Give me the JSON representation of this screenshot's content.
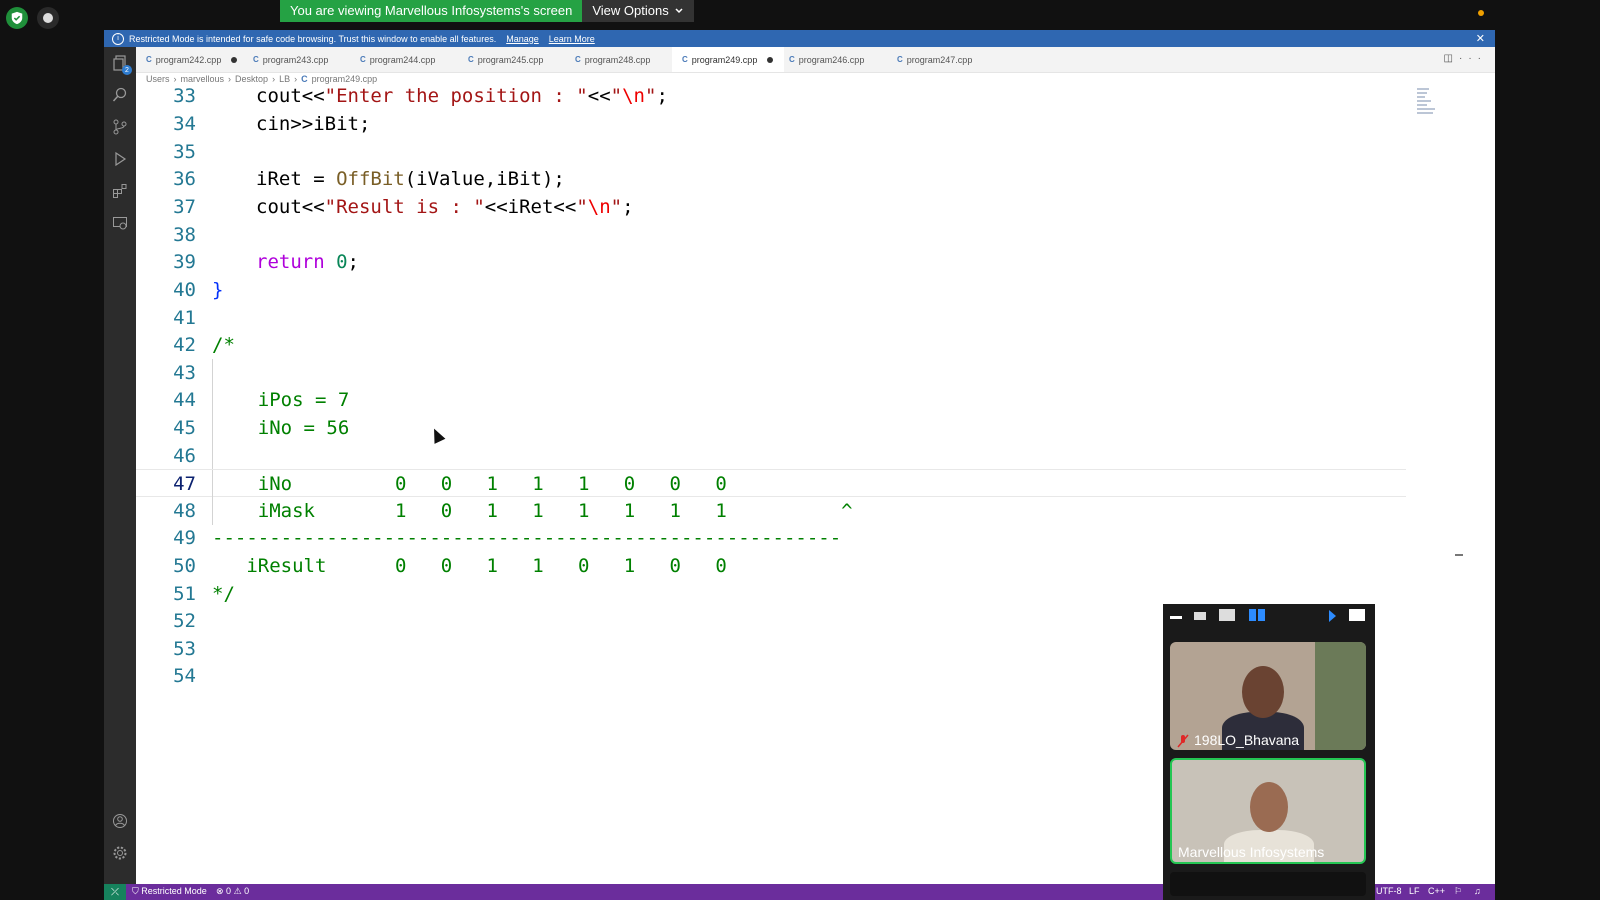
{
  "zoom": {
    "share_banner": "You are viewing Marvellous Infosystems's screen",
    "view_options": "View Options",
    "participants": [
      {
        "name": "198LO_Bhavana",
        "muted": true
      },
      {
        "name": "Marvellous Infosystems",
        "active_speaker": true
      }
    ]
  },
  "restricted_bar": {
    "message": "Restricted Mode is intended for safe code browsing. Trust this window to enable all features.",
    "manage": "Manage",
    "learn_more": "Learn More"
  },
  "tabs": [
    {
      "label": "program242.cpp",
      "modified": true
    },
    {
      "label": "program243.cpp",
      "modified": false
    },
    {
      "label": "program244.cpp",
      "modified": false
    },
    {
      "label": "program245.cpp",
      "modified": false
    },
    {
      "label": "program248.cpp",
      "modified": false
    },
    {
      "label": "program249.cpp",
      "modified": true,
      "active": true
    },
    {
      "label": "program246.cpp",
      "modified": false
    },
    {
      "label": "program247.cpp",
      "modified": false
    }
  ],
  "breadcrumb": [
    "Users",
    "marvellous",
    "Desktop",
    "LB",
    "program249.cpp"
  ],
  "editor": {
    "line_numbers": [
      "33",
      "34",
      "35",
      "36",
      "37",
      "38",
      "39",
      "40",
      "41",
      "42",
      "43",
      "44",
      "45",
      "46",
      "47",
      "48",
      "49",
      "50",
      "51",
      "52",
      "53",
      "54"
    ],
    "current_line": "47",
    "code": {
      "l33_a": "cout<<",
      "l33_b": "\"Enter the position : \"",
      "l33_c": "<<",
      "l33_d": "\"",
      "l33_e": "\\n",
      "l33_f": "\"",
      "l33_g": ";",
      "l34": "cin>>iBit;",
      "l36_a": "iRet = ",
      "l36_b": "OffBit",
      "l36_c": "(iValue,iBit);",
      "l37_a": "cout<<",
      "l37_b": "\"Result is : \"",
      "l37_c": "<<iRet<<",
      "l37_d": "\"",
      "l37_e": "\\n",
      "l37_f": "\"",
      "l37_g": ";",
      "l39_a": "return",
      "l39_b": " 0",
      "l39_c": ";",
      "l40": "}",
      "l42": "/*",
      "l44": "    iPos = 7",
      "l45": "    iNo = 56",
      "l47": "    iNo         0   0   1   1   1   0   0   0",
      "l48": "    iMask       1   0   1   1   1   1   1   1          ^",
      "l49": "-------------------------------------------------------",
      "l50": "   iResult      0   0   1   1   0   1   0   0",
      "l51": "*/"
    }
  },
  "statusbar": {
    "restricted": "Restricted Mode",
    "problems": "0",
    "warnings": "0",
    "encoding": "UTF-8",
    "eol": "LF",
    "language": "C++"
  }
}
